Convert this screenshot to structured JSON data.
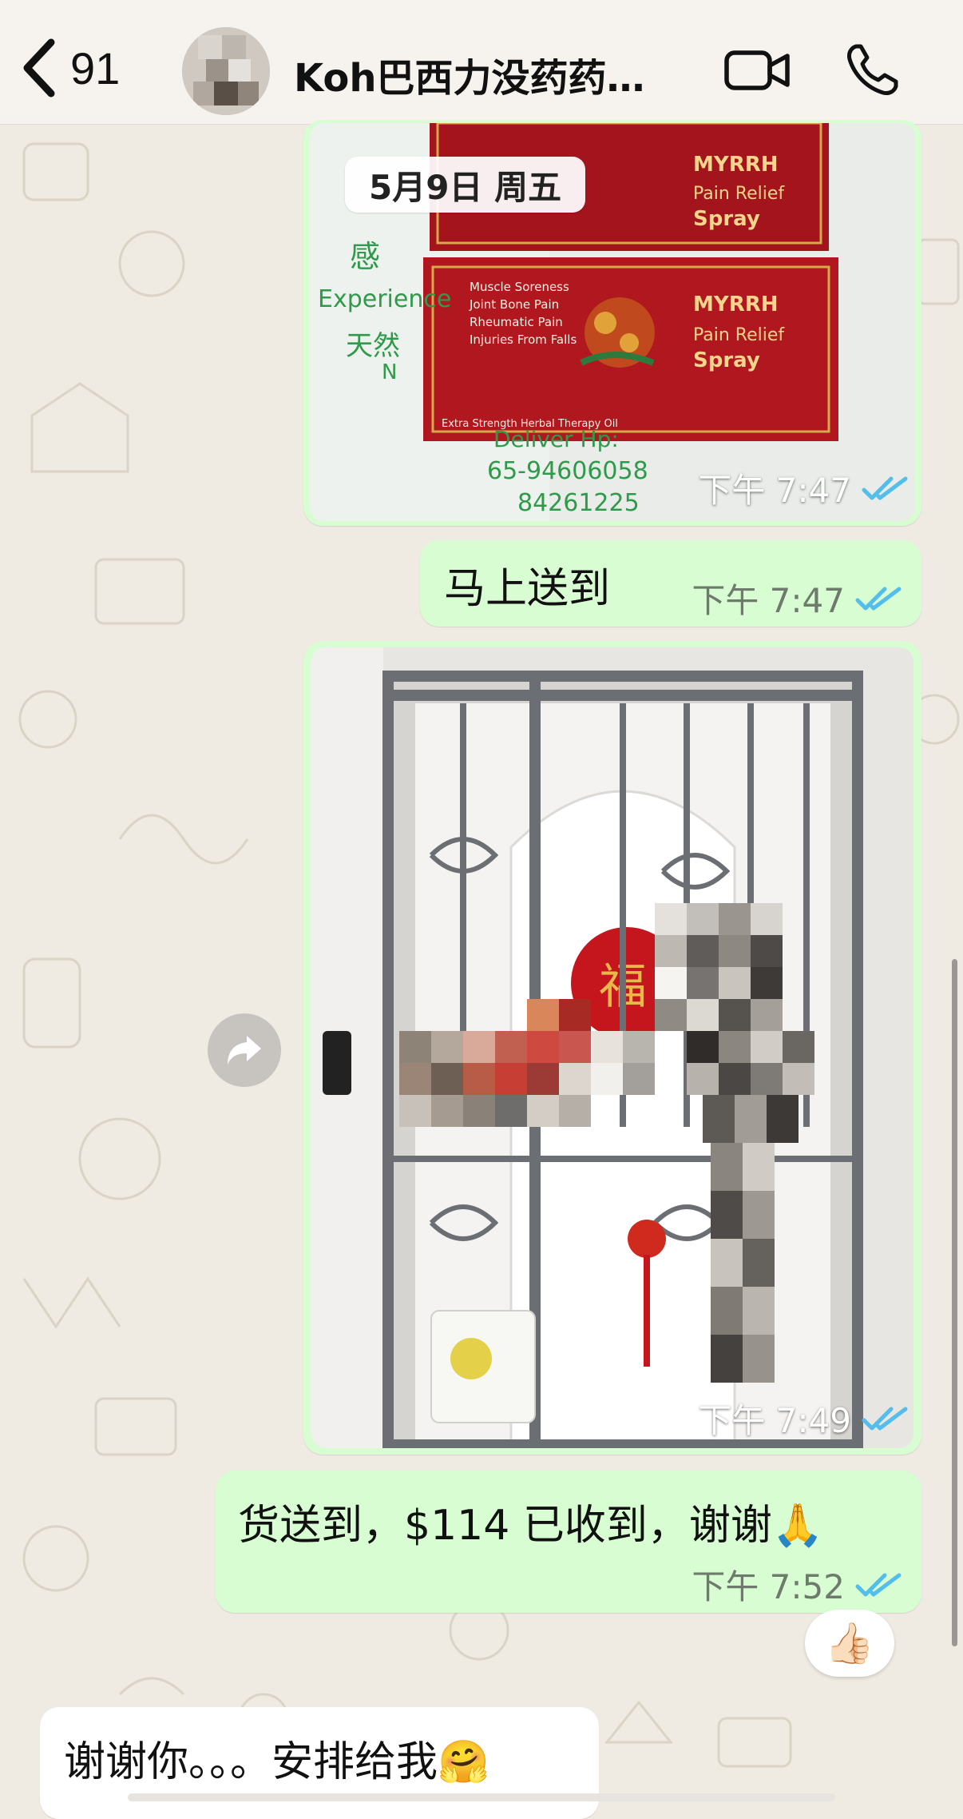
{
  "header": {
    "back_count": "91",
    "contact_name": "Koh巴西力没药药油…",
    "icons": {
      "back": "chevron-left-icon",
      "video": "video-camera-icon",
      "call": "phone-icon"
    }
  },
  "date_separator": "5月9日 周五",
  "messages": [
    {
      "type": "image",
      "direction": "outgoing",
      "content": {
        "box_texts": [
          "MYRRH",
          "Pain Relief",
          "Spray"
        ],
        "box_bullets": [
          "Muscle Soreness",
          "Joint Bone Pain",
          "Rheumatic Pain",
          "Injuries From Falls"
        ],
        "box_side": "Extra Strength Herbal Therapy Oil",
        "bag_texts": [
          "感",
          "Experience",
          "天然",
          "N",
          "Deliver Hp:",
          "65-94606058",
          "84261225"
        ]
      },
      "time": "下午 7:47",
      "status": "read"
    },
    {
      "type": "text",
      "direction": "outgoing",
      "text": "马上送到",
      "time": "下午 7:47",
      "status": "read"
    },
    {
      "type": "image",
      "direction": "outgoing",
      "content": {
        "decor_char": "福"
      },
      "time": "下午 7:49",
      "status": "read"
    },
    {
      "type": "text",
      "direction": "outgoing",
      "text": "货送到，$114 已收到，谢谢🙏",
      "time": "下午 7:52",
      "status": "read",
      "reaction": "👍🏻"
    },
    {
      "type": "text",
      "direction": "incoming",
      "text": "谢谢你。。。安排给我🤗"
    }
  ],
  "colors": {
    "outgoing_bubble": "#d9fdd3",
    "incoming_bubble": "#ffffff",
    "read_tick": "#53bdeb",
    "wallpaper": "#efeae2"
  }
}
